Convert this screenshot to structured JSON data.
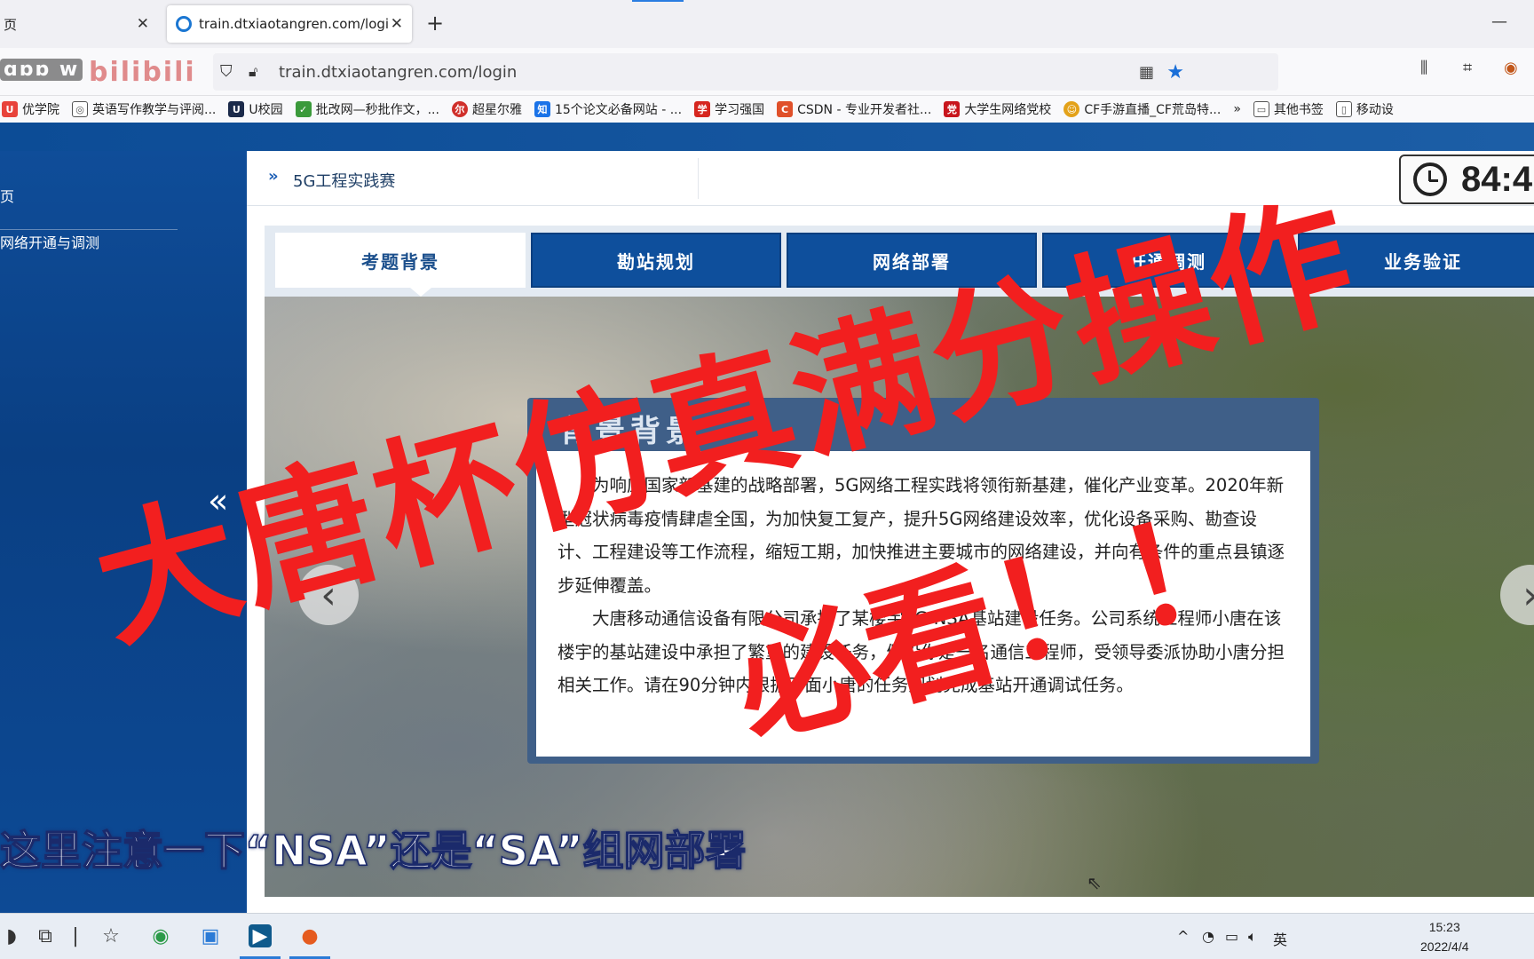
{
  "browser": {
    "inactive_tab": "页",
    "active_tab_title": "train.dtxiaotangren.com/logi",
    "url": "train.dtxiaotangren.com/login",
    "bookmarks": [
      {
        "label": "优学院",
        "color": "#e8433b"
      },
      {
        "label": "英语写作教学与评阅...",
        "color": "#555555"
      },
      {
        "label": "U校园",
        "color": "#1b2a4a"
      },
      {
        "label": "批改网—秒批作文，...",
        "color": "#3b9a3b"
      },
      {
        "label": "超星尔雅",
        "color": "#d0302b"
      },
      {
        "label": "15个论文必备网站 - ...",
        "color": "#1a73e8"
      },
      {
        "label": "学习强国",
        "color": "#d6261f"
      },
      {
        "label": "CSDN - 专业开发者社...",
        "color": "#e0502a"
      },
      {
        "label": "大学生网络党校",
        "color": "#c8161d"
      },
      {
        "label": "CF手游直播_CF荒岛特...",
        "color": "#e3a21a"
      }
    ],
    "more_label": "»",
    "other_bookmarks": "其他书签",
    "mobile_bookmarks": "移动设"
  },
  "sidebar": {
    "items": [
      {
        "label": "页"
      },
      {
        "label": "网络开通与调测"
      }
    ]
  },
  "breadcrumb": "5G工程实践赛",
  "timer": "84:4",
  "tabs": [
    {
      "label": "考题背景",
      "active": true
    },
    {
      "label": "勘站规划",
      "active": false
    },
    {
      "label": "网络部署",
      "active": false
    },
    {
      "label": "开通调测",
      "active": false
    },
    {
      "label": "业务验证",
      "active": false
    }
  ],
  "background_card": {
    "title": "背景背景",
    "paragraph1": "为响应国家新基建的战略部署，5G网络工程实践将领衔新基建，催化产业变革。2020年新型冠状病毒疫情肆虐全国，为加快复工复产，提升5G网络建设效率，优化设备采购、勘查设计、工程建设等工作流程，缩短工期，加快推进主要城市的网络建设，并向有条件的重点县镇逐步延伸覆盖。",
    "paragraph2": "大唐移动通信设备有限公司承接了某楼宇5G NSA基站建设任务。公司系统工程师小唐在该楼宇的基站建设中承担了繁重的建设任务，假设你是一名通信工程师，受领导委派协助小唐分担相关工作。请在90分钟内根据下面小唐的任务规划完成基站开通调试任务。"
  },
  "overlay": {
    "line1": "大唐杯仿真满分操作",
    "line2": "必看！！"
  },
  "subtitle": "这里注意一下“NSA”还是“SA”组网部署",
  "taskbar": {
    "time": "15:23",
    "date": "2022/4/4",
    "ime": "英"
  }
}
